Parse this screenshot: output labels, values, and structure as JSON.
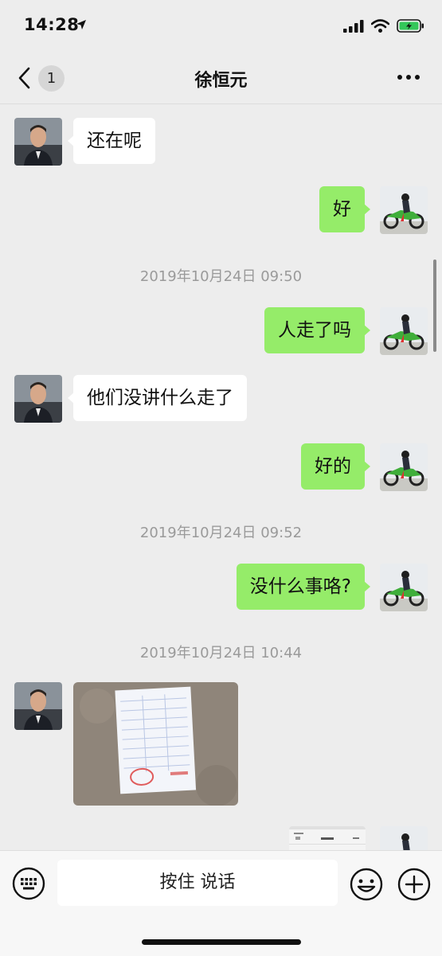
{
  "status_bar": {
    "time": "14:28"
  },
  "header": {
    "back_badge": "1",
    "title": "徐恒元"
  },
  "messages": [
    {
      "side": "in",
      "text": "还在呢"
    },
    {
      "side": "out",
      "text": "好"
    },
    {
      "timestamp": "2019年10月24日 09:50"
    },
    {
      "side": "out",
      "text": "人走了吗"
    },
    {
      "side": "in",
      "text": "他们没讲什么走了"
    },
    {
      "side": "out",
      "text": "好的"
    },
    {
      "timestamp": "2019年10月24日 09:52"
    },
    {
      "side": "out",
      "text": "没什么事咯?"
    },
    {
      "timestamp": "2019年10月24日 10:44"
    },
    {
      "side": "in",
      "type": "image",
      "content": "photo-of-receipt"
    },
    {
      "side": "out",
      "type": "image",
      "content": "chat-screenshot"
    }
  ],
  "input_bar": {
    "hold_to_talk": "按住 说话"
  },
  "colors": {
    "background": "#ededed",
    "outgoing_bubble": "#95ec69",
    "incoming_bubble": "#ffffff"
  },
  "icons": [
    "location-arrow-icon",
    "signal-icon",
    "wifi-icon",
    "battery-icon",
    "back-chevron-icon",
    "more-icon",
    "keyboard-icon",
    "emoji-icon",
    "plus-icon"
  ]
}
